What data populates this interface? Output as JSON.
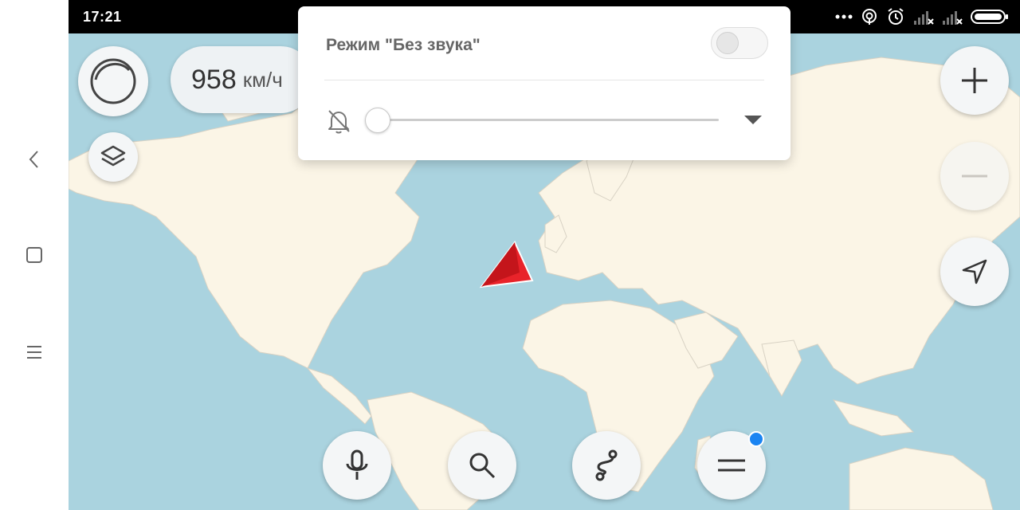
{
  "status_bar": {
    "time": "17:21",
    "icons": [
      "more-dots-icon",
      "hotspot-icon",
      "alarm-icon",
      "signal-no-service-icon",
      "signal-no-service-icon",
      "battery-icon"
    ]
  },
  "nav_bar": {
    "icons": [
      "back-icon",
      "home-icon",
      "menu-icon"
    ]
  },
  "speedometer": {
    "value": "958",
    "unit": "км/ч"
  },
  "volume_popup": {
    "title": "Режим \"Без звука\"",
    "silent_mode_enabled": false,
    "volume_level": 0,
    "icons": [
      "bell-muted-icon",
      "dropdown-arrow-icon"
    ]
  },
  "map_controls": {
    "left": [
      "compass-icon",
      "layers-icon"
    ],
    "right": [
      "zoom-in-icon",
      "zoom-out-icon",
      "location-arrow-icon"
    ],
    "bottom": [
      "microphone-icon",
      "search-icon",
      "route-icon",
      "menu-icon"
    ],
    "notification_dot": true
  },
  "colors": {
    "water": "#aad3df",
    "land": "#fbf5e6",
    "status_bar": "#000000",
    "position_marker": "#e8232a",
    "notification_dot": "#1a84f2"
  }
}
